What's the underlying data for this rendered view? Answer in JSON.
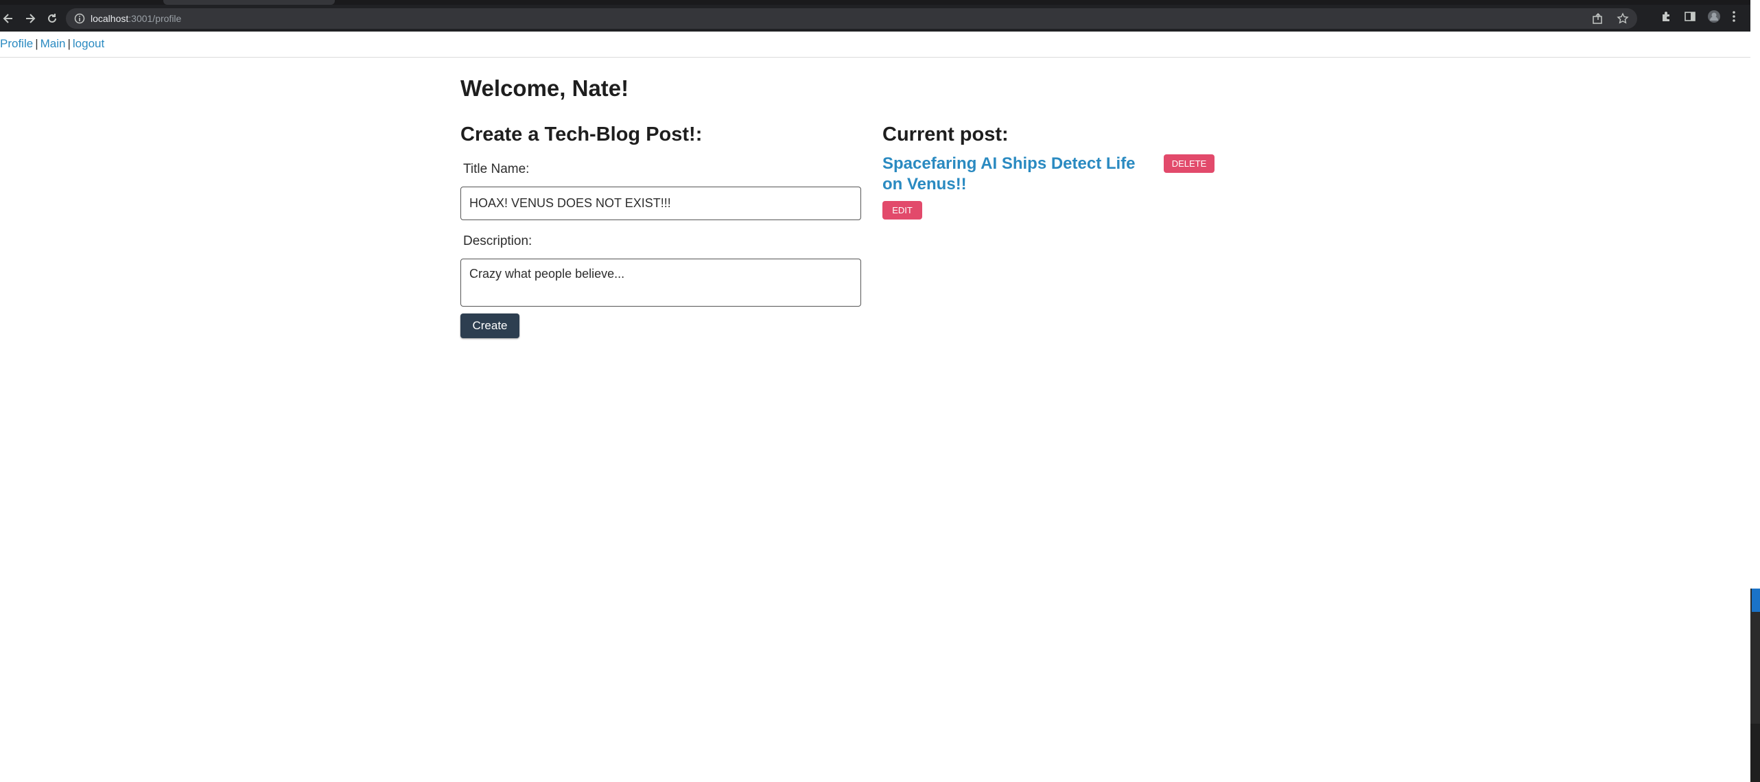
{
  "browser": {
    "url_host": "localhost",
    "url_rest": ":3001/profile"
  },
  "nav": {
    "profile": "Profile",
    "sep1": "|",
    "main": "Main",
    "sep2": "|",
    "logout": "logout"
  },
  "welcome": "Welcome, Nate!",
  "create_form": {
    "heading": "Create a Tech-Blog Post!:",
    "title_label": "Title Name:",
    "title_value": "HOAX! VENUS DOES NOT EXIST!!!",
    "description_label": "Description:",
    "description_value": "Crazy what people believe...",
    "create_label": "Create"
  },
  "current_post": {
    "heading": "Current post:",
    "post_title": "Spacefaring AI Ships Detect Life on Venus!!",
    "delete_label": "DELETE",
    "edit_label": "EDIT"
  },
  "colors": {
    "link": "#2a8ac1",
    "primary_button": "#2d3e50",
    "danger_button": "#e24a6b",
    "chrome": "#202124"
  },
  "icons": [
    "back-icon",
    "forward-icon",
    "reload-icon",
    "info-icon",
    "share-icon",
    "star-icon",
    "extensions-icon",
    "side-panel-icon",
    "profile-icon",
    "menu-icon"
  ]
}
